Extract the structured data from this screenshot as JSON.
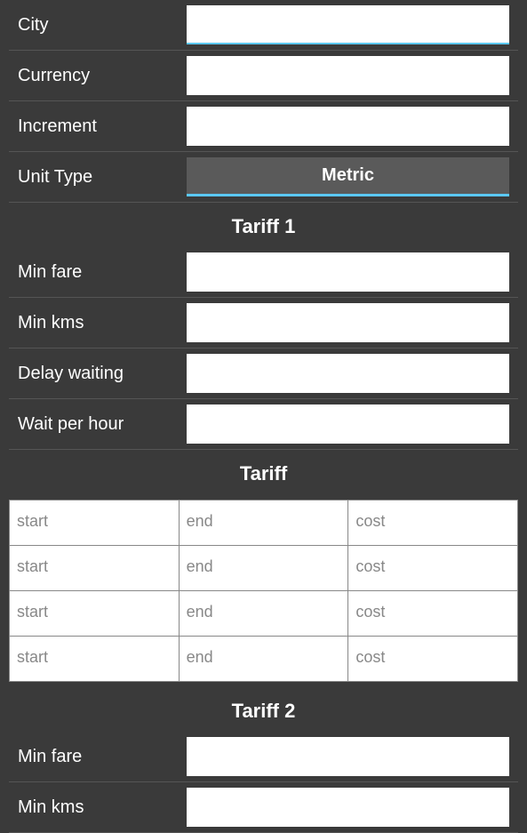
{
  "form": {
    "city_label": "City",
    "currency_label": "Currency",
    "increment_label": "Increment",
    "unit_type_label": "Unit Type",
    "unit_type_value": "Metric",
    "tariff1_title": "Tariff 1",
    "min_fare_label": "Min fare",
    "min_kms_label": "Min kms",
    "delay_waiting_label": "Delay waiting",
    "wait_per_hour_label": "Wait per hour",
    "tariff_title": "Tariff",
    "tariff_rows": [
      {
        "start_placeholder": "start",
        "end_placeholder": "end",
        "cost_placeholder": "cost"
      },
      {
        "start_placeholder": "start",
        "end_placeholder": "end",
        "cost_placeholder": "cost"
      },
      {
        "start_placeholder": "start",
        "end_placeholder": "end",
        "cost_placeholder": "cost"
      },
      {
        "start_placeholder": "start",
        "end_placeholder": "end",
        "cost_placeholder": "cost"
      }
    ],
    "tariff2_title": "Tariff 2",
    "min_fare2_label": "Min fare",
    "min_kms2_label": "Min kms"
  }
}
